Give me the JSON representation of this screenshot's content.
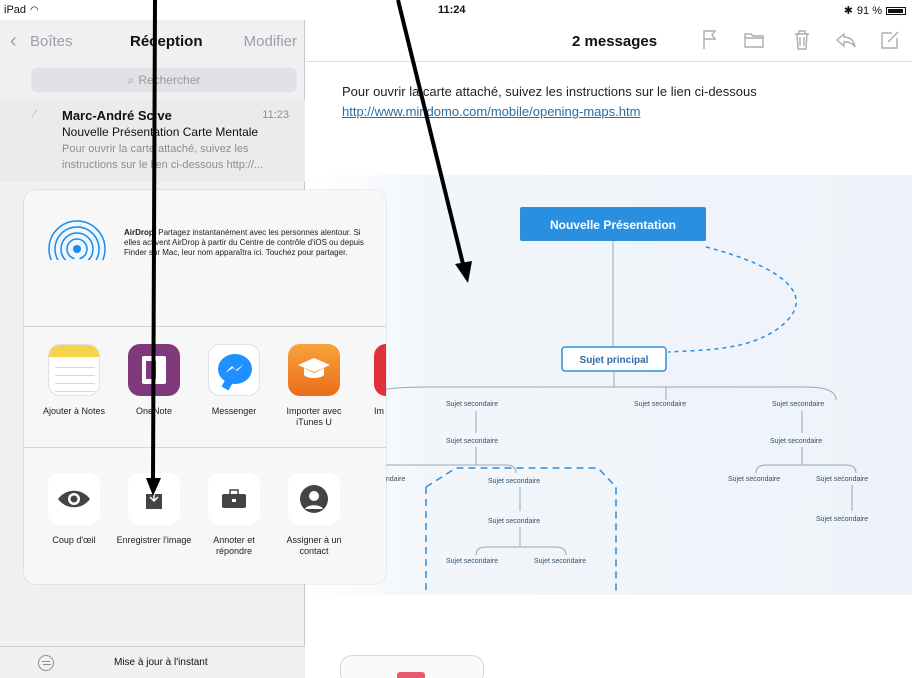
{
  "status_bar": {
    "device": "iPad",
    "time": "11:24",
    "battery": "91 %"
  },
  "left_nav": {
    "back_label": "Boîtes",
    "title": "Réception",
    "edit_label": "Modifier"
  },
  "search": {
    "placeholder": "Rechercher"
  },
  "mail": {
    "sender": "Marc-André Scive",
    "time": "11:23",
    "subject": "Nouvelle Présentation Carte Mentale",
    "preview": "Pour ouvrir la carte attaché, suivez les instructions sur le lien ci-dessous http://..."
  },
  "bottom_bar": {
    "status": "Mise à jour à l'instant"
  },
  "message": {
    "title": "2 messages",
    "body": "Pour ouvrir la carte attaché, suivez les instructions sur le lien ci-dessous",
    "link": "http://www.mindomo.com/mobile/opening-maps.htm"
  },
  "toolbar_icons": [
    "flag-icon",
    "folder-icon",
    "trash-icon",
    "reply-icon",
    "compose-icon"
  ],
  "mindmap": {
    "root": "Nouvelle Présentation",
    "main": "Sujet principal",
    "secondary": [
      "Sujet secondaire",
      "Sujet secondaire",
      "Sujet secondaire",
      "Sujet secondaire",
      "Sujet secondaire",
      "Sujet secondaire",
      "Sujet secondaire",
      "Sujet secondaire",
      "Sujet secondaire",
      "Sujet secondaire",
      "Sujet secondaire",
      "Sujet secondaire",
      "Sujet secondaire"
    ],
    "partial_left": "ondaire",
    "colors": {
      "root": "#2b8fe0",
      "main_border": "#2b8fe0",
      "dashed": "#2b8fe0"
    }
  },
  "share_sheet": {
    "airdrop_title": "AirDrop",
    "airdrop_text": ". Partagez instantanément avec les personnes alentour. Si elles activent AirDrop à partir du Centre de contrôle d'iOS ou depuis Finder sur Mac, leur nom apparaîtra ici. Touchez pour partager.",
    "apps": [
      {
        "label": "Ajouter à Notes",
        "icon": "notes-icon",
        "color": "#f5d34a"
      },
      {
        "label": "OneNote",
        "icon": "onenote-icon",
        "color": "#80397b"
      },
      {
        "label": "Messenger",
        "icon": "messenger-icon",
        "color": "#1e90ff"
      },
      {
        "label": "Importer avec iTunes U",
        "icon": "itunes-u-icon",
        "color": "#f08a24"
      },
      {
        "label": "Im",
        "icon": "partial-app-icon",
        "color": "#e0303a"
      }
    ],
    "actions": [
      {
        "label": "Coup d'œil",
        "icon": "eye-icon"
      },
      {
        "label": "Enregistrer l'image",
        "icon": "save-image-icon"
      },
      {
        "label": "Annoter et répondre",
        "icon": "toolbox-icon"
      },
      {
        "label": "Assigner à un contact",
        "icon": "contact-icon"
      }
    ]
  }
}
